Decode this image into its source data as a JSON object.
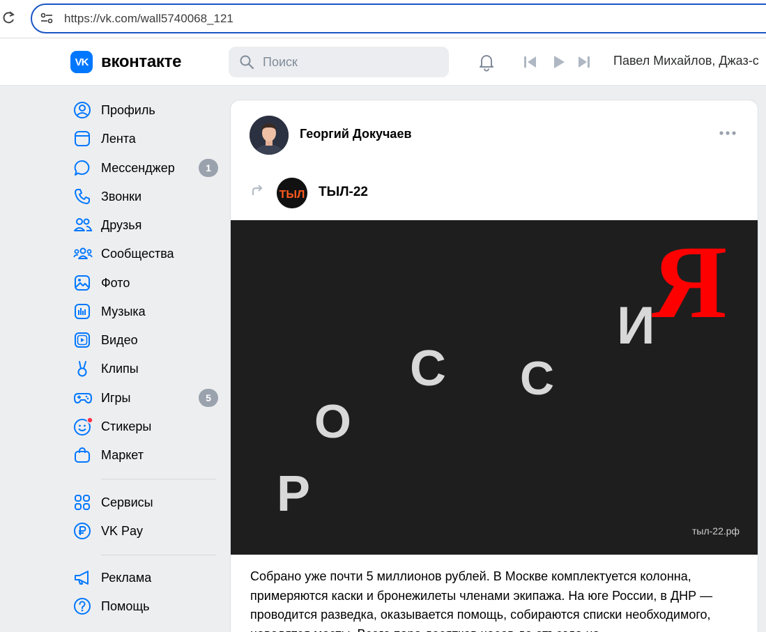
{
  "browser": {
    "url": "https://vk.com/wall5740068_121"
  },
  "header": {
    "logo_mark": "VK",
    "logo_text": "вконтакте",
    "search_placeholder": "Поиск",
    "now_playing": "Павел Михайлов, Джаз-с"
  },
  "sidebar": {
    "items": [
      {
        "label": "Профиль",
        "icon": "profile-icon"
      },
      {
        "label": "Лента",
        "icon": "feed-icon"
      },
      {
        "label": "Мессенджер",
        "icon": "messenger-icon",
        "badge": "1"
      },
      {
        "label": "Звонки",
        "icon": "phone-icon"
      },
      {
        "label": "Друзья",
        "icon": "friends-icon"
      },
      {
        "label": "Сообщества",
        "icon": "communities-icon"
      },
      {
        "label": "Фото",
        "icon": "photo-icon"
      },
      {
        "label": "Музыка",
        "icon": "music-icon"
      },
      {
        "label": "Видео",
        "icon": "video-icon"
      },
      {
        "label": "Клипы",
        "icon": "clips-icon"
      },
      {
        "label": "Игры",
        "icon": "games-icon",
        "badge": "5"
      },
      {
        "label": "Стикеры",
        "icon": "stickers-icon"
      },
      {
        "label": "Маркет",
        "icon": "market-icon"
      },
      {
        "label": "Сервисы",
        "icon": "services-icon"
      },
      {
        "label": "VK Pay",
        "icon": "vkpay-icon"
      },
      {
        "label": "Реклама",
        "icon": "ads-icon"
      },
      {
        "label": "Помощь",
        "icon": "help-icon"
      }
    ]
  },
  "post": {
    "author": "Георгий Докучаев",
    "repost_source": "ТЫЛ-22",
    "group_avatar_text": "ТЫЛ",
    "image": {
      "letters": [
        "Р",
        "О",
        "С",
        "С",
        "И",
        "Я"
      ],
      "watermark": "тыл-22.рф"
    },
    "text": "Собрано уже почти 5 миллионов рублей. В Москве комплектуется колонна, примеряются каски и бронежилеты членами экипажа. На юге России, в ДНР — проводится разведка, оказывается помощь, собираются списки необходимого, наводятся мосты. Всего пара десятков часов до отъезда на"
  },
  "colors": {
    "accent": "#0077ff",
    "badge": "#99a2ad",
    "notification_dot": "#ff3347",
    "flag_red": "#ff0000"
  }
}
